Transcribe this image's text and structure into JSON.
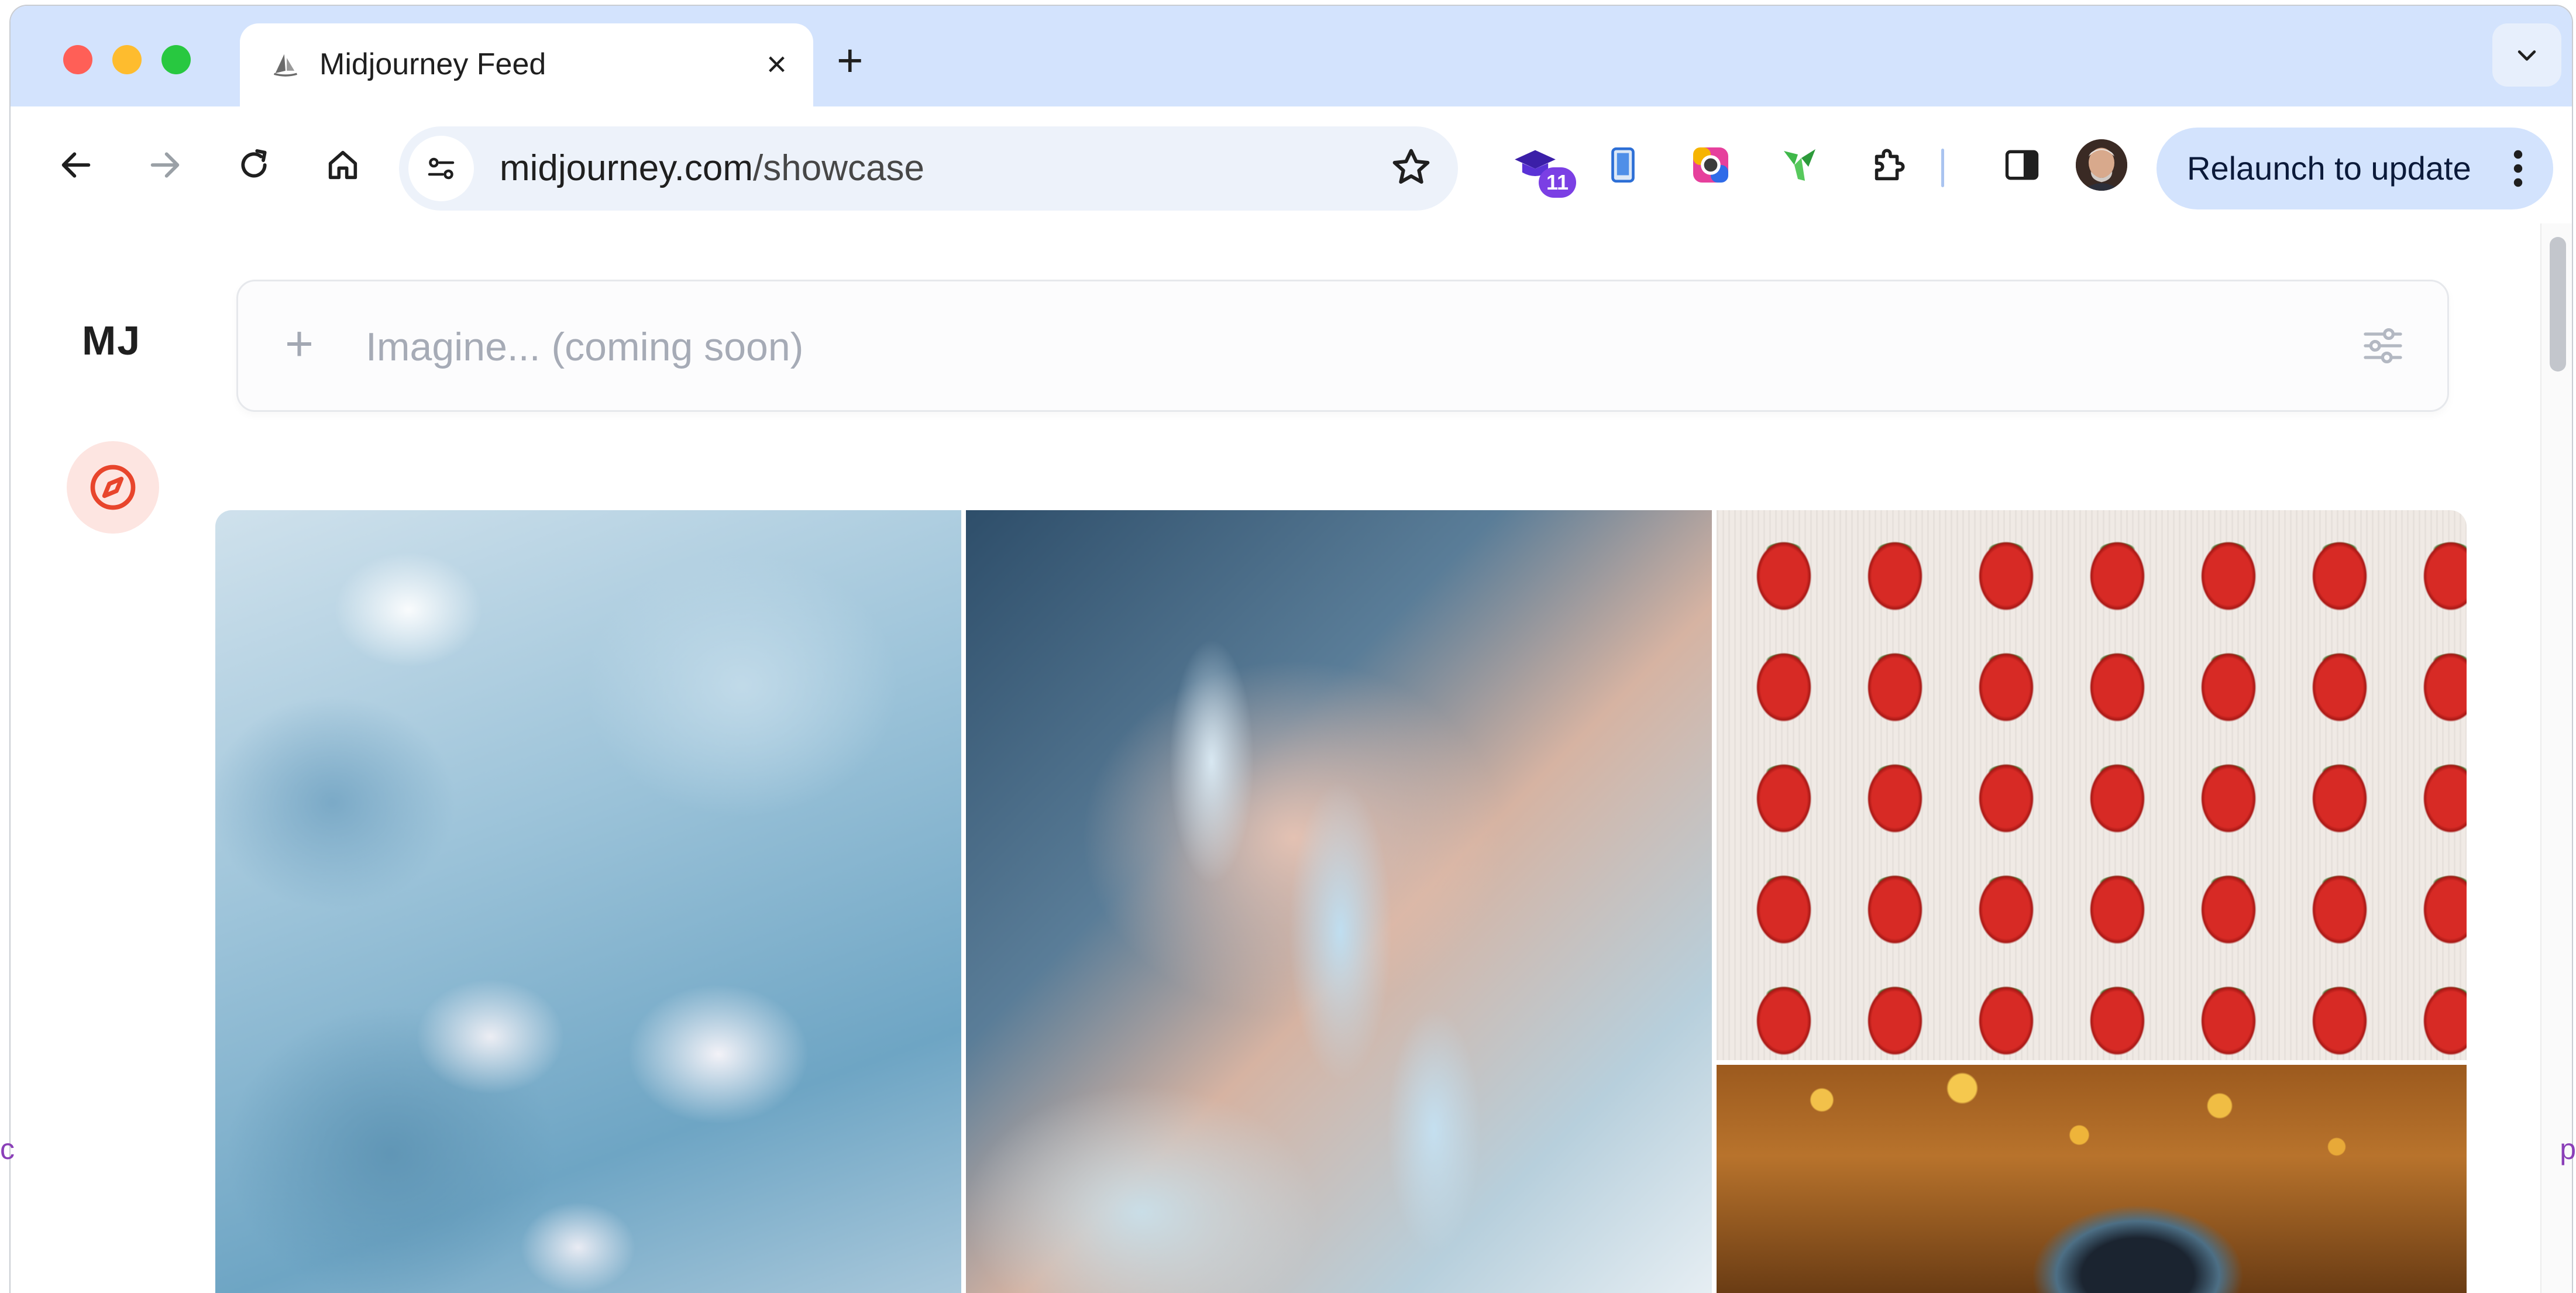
{
  "browser": {
    "tab": {
      "title": "Midjourney Feed",
      "close_label": "×"
    },
    "new_tab_label": "+",
    "address": {
      "host": "midjourney.com",
      "path": "/showcase"
    },
    "extensions": [
      {
        "name": "extension-graduation-icon",
        "badge": "11"
      },
      {
        "name": "extension-phone-icon"
      },
      {
        "name": "extension-color-ring-icon"
      },
      {
        "name": "extension-green-leaf-icon"
      },
      {
        "name": "extensions-puzzle-icon"
      }
    ],
    "relaunch_label": "Relaunch to update"
  },
  "app": {
    "logo": "MJ",
    "prompt_placeholder": "Imagine... (coming soon)",
    "prompt_plus": "+",
    "gallery": [
      {
        "name": "gallery-image-blue-flowers"
      },
      {
        "name": "gallery-image-crystal-nails"
      },
      {
        "name": "gallery-image-knitted-strawberries"
      },
      {
        "name": "gallery-image-golden-eye"
      }
    ]
  },
  "edge_fragments": {
    "left": "c",
    "right": "p"
  },
  "colors": {
    "tabbar_bg": "#d3e3fd",
    "omnibox_bg": "#edf2fa",
    "accent_explore": "#e8452c",
    "relaunch_bg": "#d3e3fd"
  }
}
